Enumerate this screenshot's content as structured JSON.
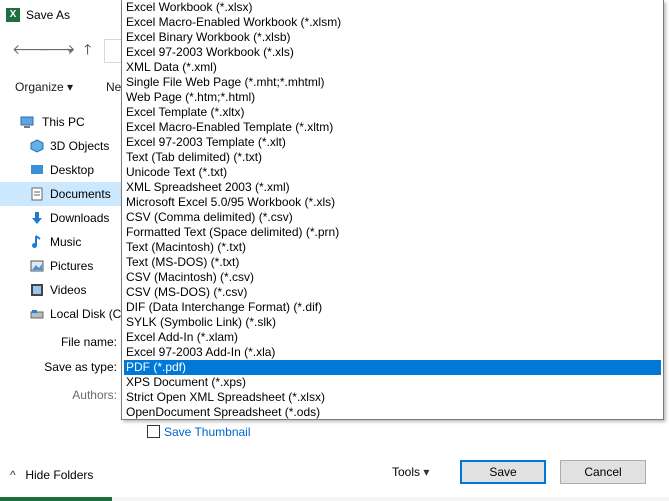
{
  "window": {
    "title": "Save As",
    "app_icon": "X"
  },
  "nav": {
    "back": "🡐",
    "forward": "🡒",
    "history": "⌄",
    "up": "🡑"
  },
  "toolbar": {
    "organize": "Organize ▾",
    "new_folder": "Ne"
  },
  "sidebar": {
    "items": [
      {
        "label": "This PC",
        "icon": "computer-icon"
      },
      {
        "label": "3D Objects",
        "icon": "cube-icon"
      },
      {
        "label": "Desktop",
        "icon": "desktop-icon"
      },
      {
        "label": "Documents",
        "icon": "document-icon",
        "selected": true
      },
      {
        "label": "Downloads",
        "icon": "download-icon"
      },
      {
        "label": "Music",
        "icon": "music-icon"
      },
      {
        "label": "Pictures",
        "icon": "picture-icon"
      },
      {
        "label": "Videos",
        "icon": "video-icon"
      },
      {
        "label": "Local Disk (C:",
        "icon": "disk-icon"
      }
    ]
  },
  "form": {
    "file_name_label": "File name:",
    "save_as_type_label": "Save as type:",
    "authors_label": "Authors:"
  },
  "file_types": [
    "Excel Workbook (*.xlsx)",
    "Excel Macro-Enabled Workbook (*.xlsm)",
    "Excel Binary Workbook (*.xlsb)",
    "Excel 97-2003 Workbook (*.xls)",
    "XML Data (*.xml)",
    "Single File Web Page (*.mht;*.mhtml)",
    "Web Page (*.htm;*.html)",
    "Excel Template (*.xltx)",
    "Excel Macro-Enabled Template (*.xltm)",
    "Excel 97-2003 Template (*.xlt)",
    "Text (Tab delimited) (*.txt)",
    "Unicode Text (*.txt)",
    "XML Spreadsheet 2003 (*.xml)",
    "Microsoft Excel 5.0/95 Workbook (*.xls)",
    "CSV (Comma delimited) (*.csv)",
    "Formatted Text (Space delimited) (*.prn)",
    "Text (Macintosh) (*.txt)",
    "Text (MS-DOS) (*.txt)",
    "CSV (Macintosh) (*.csv)",
    "CSV (MS-DOS) (*.csv)",
    "DIF (Data Interchange Format) (*.dif)",
    "SYLK (Symbolic Link) (*.slk)",
    "Excel Add-In (*.xlam)",
    "Excel 97-2003 Add-In (*.xla)",
    "PDF (*.pdf)",
    "XPS Document (*.xps)",
    "Strict Open XML Spreadsheet (*.xlsx)",
    "OpenDocument Spreadsheet (*.ods)"
  ],
  "selected_file_type": "PDF (*.pdf)",
  "save_thumbnail": {
    "label": "Save Thumbnail",
    "checked": false
  },
  "footer": {
    "hide_folders": "Hide Folders",
    "tools": "Tools",
    "save": "Save",
    "cancel": "Cancel"
  },
  "colors": {
    "selection": "#0078d7",
    "sidebar_selected": "#cce8ff",
    "excel_green": "#1d6f42"
  }
}
